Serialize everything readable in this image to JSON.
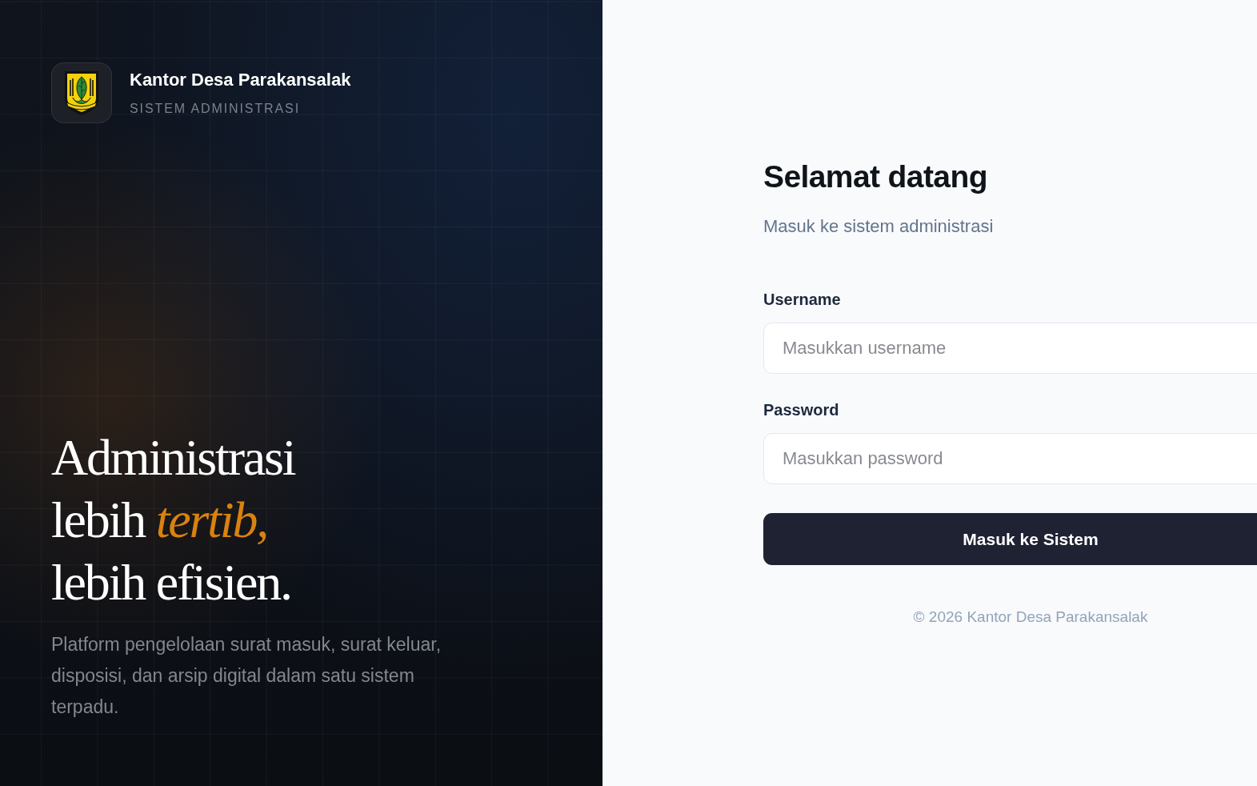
{
  "brand": {
    "name": "Kantor Desa Parakansalak",
    "tagline": "SISTEM ADMINISTRASI"
  },
  "hero": {
    "headline": [
      "Administrasi",
      "lebih *tertib,*",
      "lebih efisien."
    ],
    "description": "Platform pengelolaan surat masuk, surat keluar, disposisi, dan arsip digital dalam satu sistem terpadu."
  },
  "login": {
    "title": "Selamat datang",
    "subtitle": "Masuk ke sistem administrasi",
    "fields": [
      {
        "label": "Username",
        "placeholder": "Masukkan username"
      },
      {
        "label": "Password",
        "placeholder": "Masukkan password"
      }
    ],
    "submit": "Masuk ke Sistem",
    "footer": "© 2026 Kantor Desa Parakansalak"
  }
}
